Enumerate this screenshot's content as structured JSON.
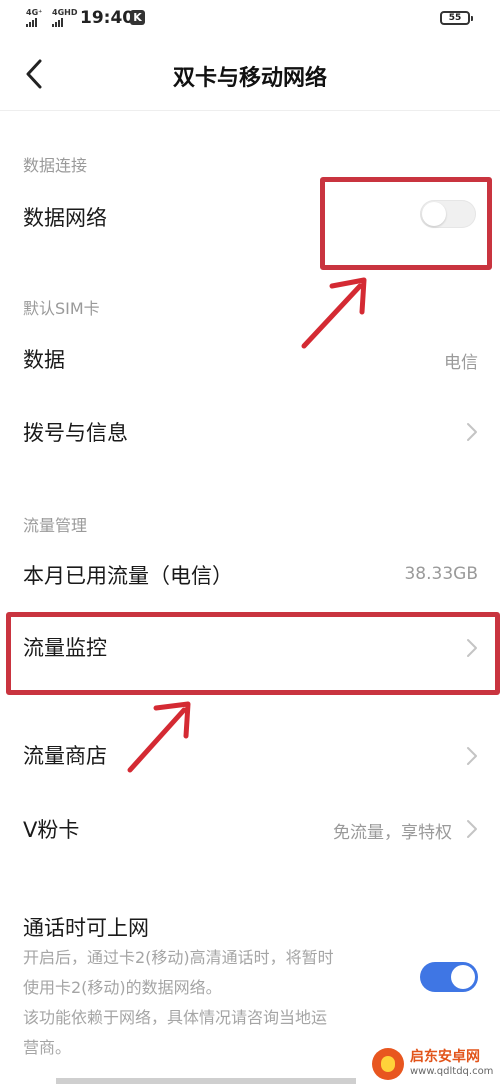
{
  "status_bar": {
    "sim1_network": "4G⁺",
    "sim2_network": "4GHD",
    "time": "19:40",
    "k_badge": "K",
    "battery": "55"
  },
  "header": {
    "title": "双卡与移动网络"
  },
  "sections": {
    "data_connection": {
      "header": "数据连接",
      "mobile_data": {
        "label": "数据网络",
        "enabled": false
      }
    },
    "default_sim": {
      "header": "默认SIM卡",
      "data": {
        "label": "数据",
        "value": "电信"
      },
      "calls_messages": {
        "label": "拨号与信息"
      }
    },
    "traffic": {
      "header": "流量管理",
      "used": {
        "label": "本月已用流量（电信）",
        "value": "38.33GB"
      },
      "monitor": {
        "label": "流量监控"
      },
      "store": {
        "label": "流量商店"
      },
      "vfan": {
        "label": "V粉卡",
        "value": "免流量，享特权"
      }
    },
    "volte_data": {
      "label": "通话时可上网",
      "desc_line1": "开启后，通过卡2(移动)高清通话时，将暂时",
      "desc_line2": "使用卡2(移动)的数据网络。",
      "desc_line3": "该功能依赖于网络，具体情况请咨询当地运",
      "desc_line4": "营商。",
      "enabled": true
    }
  },
  "watermark": {
    "name": "启东安卓网",
    "url": "www.qdltdq.com"
  },
  "colors": {
    "highlight": "#c9343f",
    "toggle_on": "#3f76e4",
    "section_header": "#9a9a9a"
  },
  "icons": [
    "back-arrow-icon",
    "chevron-right-icon",
    "annotation-arrow-icon"
  ]
}
